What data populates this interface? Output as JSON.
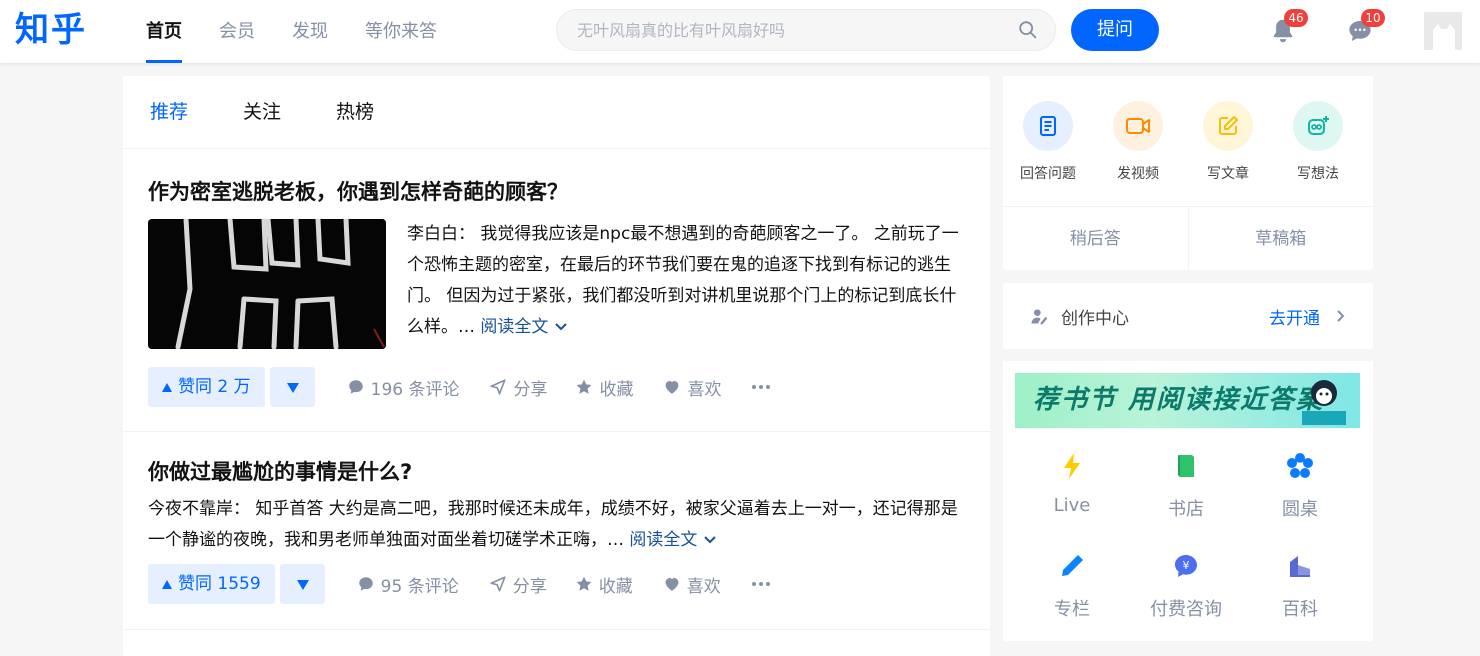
{
  "header": {
    "logo": "知乎",
    "nav": [
      "首页",
      "会员",
      "发现",
      "等你来答"
    ],
    "search_placeholder": "无叶风扇真的比有叶风扇好吗",
    "ask_label": "提问",
    "notifications_count": "46",
    "messages_count": "10"
  },
  "feed": {
    "tabs": [
      "推荐",
      "关注",
      "热榜"
    ],
    "items": [
      {
        "title": "作为密室逃脱老板，你遇到怎样奇葩的顾客？",
        "excerpt": "李白白： 我觉得我应该是npc最不想遇到的奇葩顾客之一了。 之前玩了一个恐怖主题的密室，在最后的环节我们要在鬼的追逐下找到有标记的逃生门。 但因为过于紧张，我们都没听到对讲机里说那个门上的标记到底长什么样。…",
        "read_more": "阅读全文",
        "vote_label": "赞同 2 万",
        "comments": "196 条评论",
        "share": "分享",
        "collect": "收藏",
        "like": "喜欢"
      },
      {
        "title": "你做过最尴尬的事情是什么?",
        "excerpt": "今夜不靠岸： 知乎首答 大约是高二吧，我那时候还未成年，成绩不好，被家父逼着去上一对一，还记得那是一个静谧的夜晚，我和男老师单独面对面坐着切磋学术正嗨，…",
        "read_more": "阅读全文",
        "vote_label": "赞同 1559",
        "comments": "95 条评论",
        "share": "分享",
        "collect": "收藏",
        "like": "喜欢"
      }
    ]
  },
  "sidebar": {
    "creation": [
      {
        "label": "回答问题",
        "icon": "answer-icon",
        "bg": "#e5efff",
        "color": "#0066ff"
      },
      {
        "label": "发视频",
        "icon": "video-icon",
        "bg": "#fff1e0",
        "color": "#ff8a00"
      },
      {
        "label": "写文章",
        "icon": "article-icon",
        "bg": "#fff6d9",
        "color": "#f6c000"
      },
      {
        "label": "写想法",
        "icon": "idea-icon",
        "bg": "#dff7f2",
        "color": "#10b7a0"
      }
    ],
    "later": "稍后答",
    "drafts": "草稿箱",
    "center_label": "创作中心",
    "center_action": "去开通",
    "banner_text": "荐书节 用阅读接近答案",
    "services": [
      {
        "label": "Live",
        "icon": "live-icon",
        "color": "#ffcc00"
      },
      {
        "label": "书店",
        "icon": "bookstore-icon",
        "color": "#2ec26a"
      },
      {
        "label": "圆桌",
        "icon": "roundtable-icon",
        "color": "#0a7cff"
      },
      {
        "label": "专栏",
        "icon": "column-icon",
        "color": "#0a84ff"
      },
      {
        "label": "付费咨询",
        "icon": "consult-icon",
        "color": "#4e6ef2"
      },
      {
        "label": "百科",
        "icon": "wiki-icon",
        "color": "#5b6ad0"
      }
    ]
  }
}
